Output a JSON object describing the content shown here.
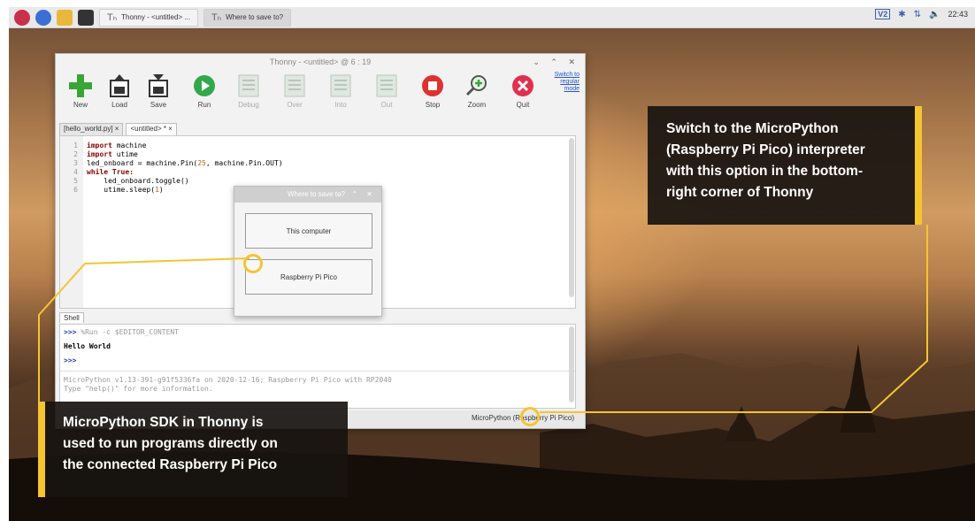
{
  "taskbar": {
    "tasks": [
      "Thonny - <untitled> ...",
      "Where to save to?"
    ],
    "clock": "22:43",
    "vnc_label": "V2"
  },
  "thonny": {
    "title": "Thonny - <untitled> @ 6 : 19",
    "toolbar": {
      "new": "New",
      "load": "Load",
      "save": "Save",
      "run": "Run",
      "debug": "Debug",
      "over": "Over",
      "into": "Into",
      "out": "Out",
      "stop": "Stop",
      "zoom": "Zoom",
      "quit": "Quit"
    },
    "switch_mode": "Switch to regular mode",
    "tabs": [
      "[hello_world.py] ×",
      "<untitled> * ×"
    ],
    "code": [
      {
        "n": "1",
        "kw": "import",
        "rest": " machine"
      },
      {
        "n": "2",
        "kw": "import",
        "rest": " utime"
      },
      {
        "n": "3",
        "text_a": "led_onboard = machine.Pin(",
        "num": "25",
        "text_b": ", machine.Pin.OUT)"
      },
      {
        "n": "4",
        "kw": "while True:",
        "rest": ""
      },
      {
        "n": "5",
        "indent": "    led_onboard.toggle()"
      },
      {
        "n": "6",
        "indent_a": "    utime.sleep(",
        "num": "1",
        "indent_b": ")"
      }
    ],
    "shell_tab": "Shell",
    "shell": {
      "prompt": ">>>",
      "run_cmd": "%Run -c $EDITOR_CONTENT",
      "output": "Hello World",
      "banner1": "MicroPython v1.13-391-g91f5336fa on 2020-12-16; Raspberry Pi Pico with RP2040",
      "banner2": "Type \"help()\" for more information."
    },
    "interpreter": "MicroPython (Raspberry Pi Pico)"
  },
  "dialog": {
    "title": "Where to save to?",
    "option_computer": "This computer",
    "option_pico": "Raspberry Pi Pico"
  },
  "callouts": {
    "right": [
      "Switch to the MicroPython",
      "(Raspberry Pi Pico) interpreter",
      "with this option in the bottom-",
      "right corner of Thonny"
    ],
    "left": [
      "MicroPython SDK in Thonny is",
      "used to run programs directly on",
      "the connected Raspberry Pi Pico"
    ]
  },
  "colors": {
    "accent": "#f4c531",
    "callout_bg": "#181410"
  }
}
